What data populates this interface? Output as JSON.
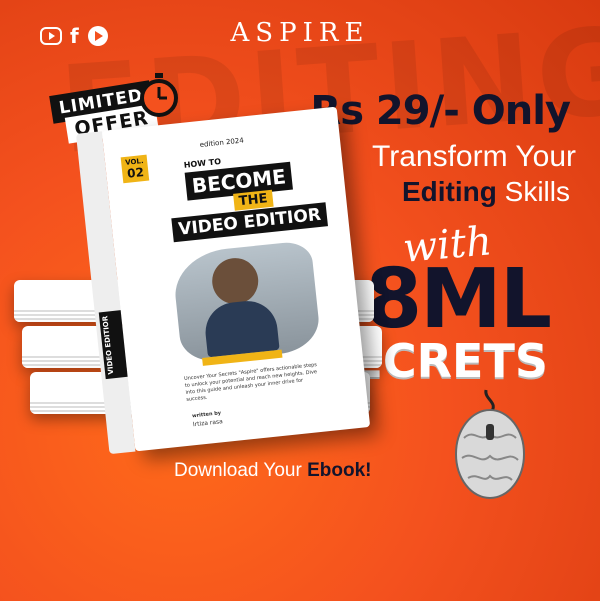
{
  "social": {
    "icons": [
      "youtube-icon",
      "facebook-icon",
      "youtube-circle-icon"
    ],
    "facebook_glyph": "f"
  },
  "brand": {
    "name": "ASPIRE"
  },
  "background_word": "EDITING",
  "offer": {
    "line1": "LIMITED",
    "line2": "OFFER"
  },
  "headline": {
    "price": "Rs 29/- Only",
    "line1": "Transform Your",
    "line2_bold": "Editing",
    "line2_rest": " Skills",
    "with": "with",
    "big": "8ML",
    "secrets": "SECRETS"
  },
  "cta": {
    "prefix": "Download Your ",
    "bold": "Ebook!"
  },
  "book": {
    "vol_label": "VOL.",
    "vol_number": "02",
    "edition": "edition 2024",
    "how_to": "HOW TO",
    "become": "BECOME",
    "the": "THE",
    "video": "VIDEO EDITIOR",
    "description": "Uncover Your Secrets \"Aspire\" offers actionable steps to unlock your potential and reach new heights. Dive into this guide and unleash your inner drive for success.",
    "written_by": "written by",
    "author": "Irtiza rasa",
    "spine": "VIDEO EDITIOR"
  },
  "colors": {
    "accent_orange": "#f4511e",
    "navy": "#12142c",
    "yellow": "#f0b416"
  }
}
